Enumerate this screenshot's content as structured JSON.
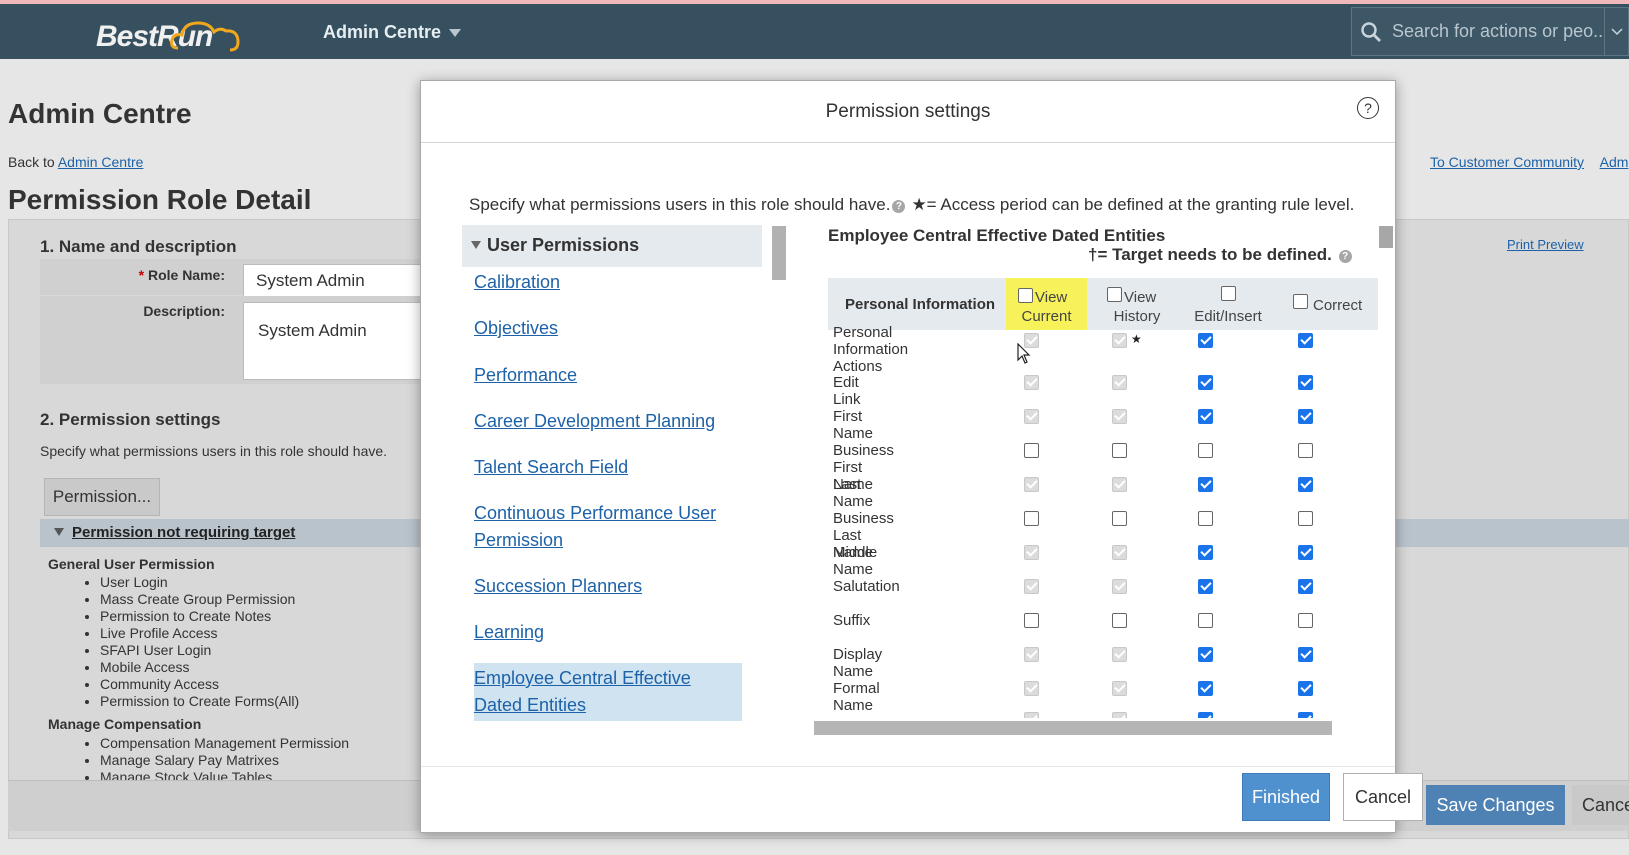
{
  "topbar": {
    "logo": "BestRun",
    "menu_label": "Admin Centre",
    "search_placeholder": "Search for actions or peo..."
  },
  "page": {
    "title": "Admin Centre",
    "back_prefix": "Back to",
    "back_link": "Admin Centre",
    "right_link_1": "To Customer Community",
    "right_link_2": "Adm",
    "detail_title": "Permission Role Detail",
    "print_preview": "Print Preview",
    "section1": "1. Name and description",
    "role_name_label": "Role Name:",
    "required_mark": "*",
    "role_name_value": "System Admin",
    "description_label": "Description:",
    "description_value": "System Admin",
    "section2": "2. Permission settings",
    "section2_desc": "Specify what permissions users in this role should have.",
    "permission_button": "Permission...",
    "group_title": "Permission not requiring target",
    "general_head": "General User Permission",
    "general_items": [
      "User Login",
      "Mass Create Group Permission",
      "Permission to Create Notes",
      "Live Profile Access",
      "SFAPI User Login",
      "Mobile Access",
      "Community Access",
      "Permission to Create Forms(All)"
    ],
    "comp_head": "Manage Compensation",
    "comp_items": [
      "Compensation Management Permission",
      "Manage Salary Pay Matrixes",
      "Manage Stock Value Tables"
    ],
    "save_button": "Save Changes",
    "cancel_button": "Cance"
  },
  "modal": {
    "title": "Permission settings",
    "help": "?",
    "desc_text": "Specify what permissions users in this role should have.",
    "desc_note": "★= Access period can be defined at the granting rule level.",
    "left_header": "User Permissions",
    "left_items": [
      "Calibration",
      "Objectives",
      "Performance",
      "Career Development Planning",
      "Talent Search Field",
      "Continuous Performance User Permission",
      "Succession Planners",
      "Learning",
      "Employee Central Effective Dated Entities"
    ],
    "right_title": "Employee Central Effective Dated Entities",
    "target_note": "†= Target needs to be defined.",
    "table_section": "Personal Information",
    "col_view_current_1": "View",
    "col_view_current_2": "Current",
    "col_view_history_1": "View",
    "col_view_history_2": "History",
    "col_edit": "Edit/Insert",
    "col_correct": "Correct",
    "rows": [
      {
        "label_1": "Personal Information",
        "label_2": "Actions",
        "vc": "dis",
        "vh": "dis",
        "ed": "on",
        "co": "on",
        "star": "★"
      },
      {
        "label_1": "Edit Link",
        "vc": "dis",
        "vh": "dis",
        "ed": "on",
        "co": "on"
      },
      {
        "label_1": "First Name",
        "vc": "dis",
        "vh": "dis",
        "ed": "on",
        "co": "on"
      },
      {
        "label_1": "Business First Name",
        "vc": "off",
        "vh": "off",
        "ed": "off",
        "co": "off"
      },
      {
        "label_1": "Last Name",
        "vc": "dis",
        "vh": "dis",
        "ed": "on",
        "co": "on"
      },
      {
        "label_1": "Business Last Name",
        "vc": "off",
        "vh": "off",
        "ed": "off",
        "co": "off"
      },
      {
        "label_1": "Middle Name",
        "vc": "dis",
        "vh": "dis",
        "ed": "on",
        "co": "on"
      },
      {
        "label_1": "Salutation",
        "vc": "dis",
        "vh": "dis",
        "ed": "on",
        "co": "on"
      },
      {
        "label_1": "Suffix",
        "vc": "off",
        "vh": "off",
        "ed": "off",
        "co": "off"
      },
      {
        "label_1": "Display Name",
        "vc": "dis",
        "vh": "dis",
        "ed": "on",
        "co": "on"
      },
      {
        "label_1": "Formal Name",
        "vc": "dis",
        "vh": "dis",
        "ed": "on",
        "co": "on"
      }
    ],
    "finished_button": "Finished",
    "cancel_button": "Cancel"
  },
  "colors": {
    "topbar": "#37505f",
    "accent_blue": "#4f90cf",
    "checkbox_blue": "#1a73e8",
    "highlight": "#f8f25a",
    "selected_item": "#cfe3f1"
  }
}
